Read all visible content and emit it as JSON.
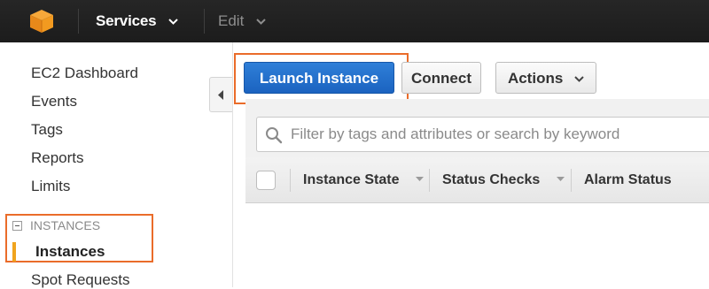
{
  "topnav": {
    "logo_icon": "aws-cube-icon",
    "services_label": "Services",
    "edit_label": "Edit",
    "accent_color": "#f7941e"
  },
  "sidebar": {
    "items": [
      {
        "label": "EC2 Dashboard"
      },
      {
        "label": "Events"
      },
      {
        "label": "Tags"
      },
      {
        "label": "Reports"
      },
      {
        "label": "Limits"
      }
    ],
    "section": {
      "title": "INSTANCES",
      "items": [
        {
          "label": "Instances",
          "active": true
        },
        {
          "label": "Spot Requests"
        }
      ]
    }
  },
  "toolbar": {
    "launch_label": "Launch Instance",
    "connect_label": "Connect",
    "actions_label": "Actions",
    "highlight_color": "#ea6c2a",
    "primary_color": "#1f6fce"
  },
  "search": {
    "placeholder": "Filter by tags and attributes or search by keyword",
    "value": ""
  },
  "table": {
    "columns": [
      {
        "label": "Instance State"
      },
      {
        "label": "Status Checks"
      },
      {
        "label": "Alarm Status"
      }
    ]
  }
}
